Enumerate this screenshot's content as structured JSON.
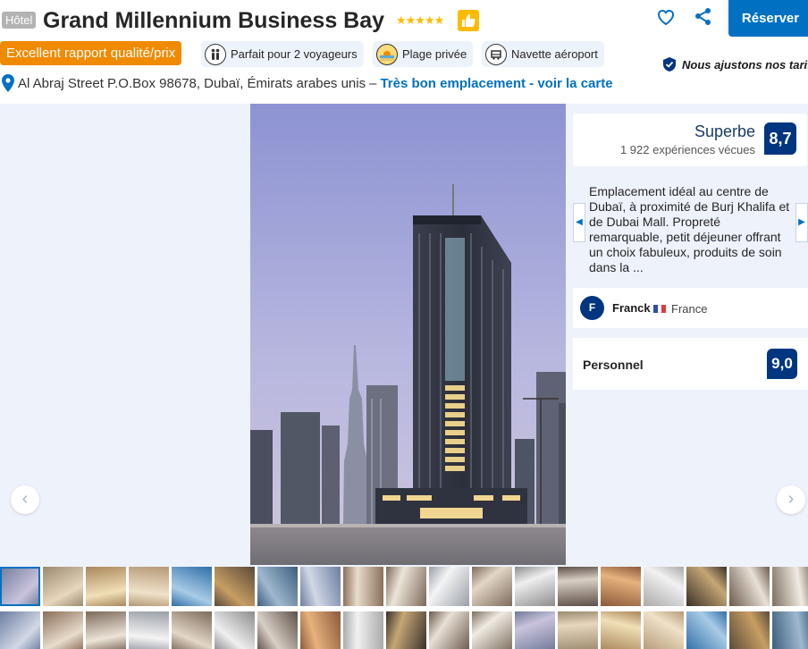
{
  "header": {
    "type_badge": "Hôtel",
    "title": "Grand Millennium Business Bay",
    "stars": "★★★★★",
    "reserve_label": "Réserver"
  },
  "chips": {
    "value": "Excellent rapport qualité/prix",
    "travelers": "Parfait pour 2 voyageurs",
    "beach": "Plage privée",
    "shuttle": "Navette aéroport"
  },
  "price_note": "Nous ajustons nos tarifs",
  "address": {
    "text": "Al Abraj Street P.O.Box 98678, Dubaï, Émirats arabes unis",
    "separator": "–",
    "link": "Très bon emplacement - voir la carte"
  },
  "score": {
    "word": "Superbe",
    "count": "1 922 expériences vécues",
    "value": "8,7"
  },
  "review": {
    "text": "Emplacement idéal au centre de Dubaï, à proximité de Burj Khalifa et de Dubai Mall. Propreté remarquable, petit déjeuner offrant un choix fabuleux, produits de soin dans la ...",
    "reviewer_initial": "F",
    "reviewer_name": "Franck",
    "reviewer_country": "France"
  },
  "staff": {
    "label": "Personnel",
    "value": "9,0"
  },
  "gallery": {
    "prev": "‹",
    "next": "›"
  },
  "colors": {
    "brand_blue": "#0071c2",
    "dark_blue": "#003580",
    "value_orange": "#f08a00",
    "star_yellow": "#febb02"
  }
}
